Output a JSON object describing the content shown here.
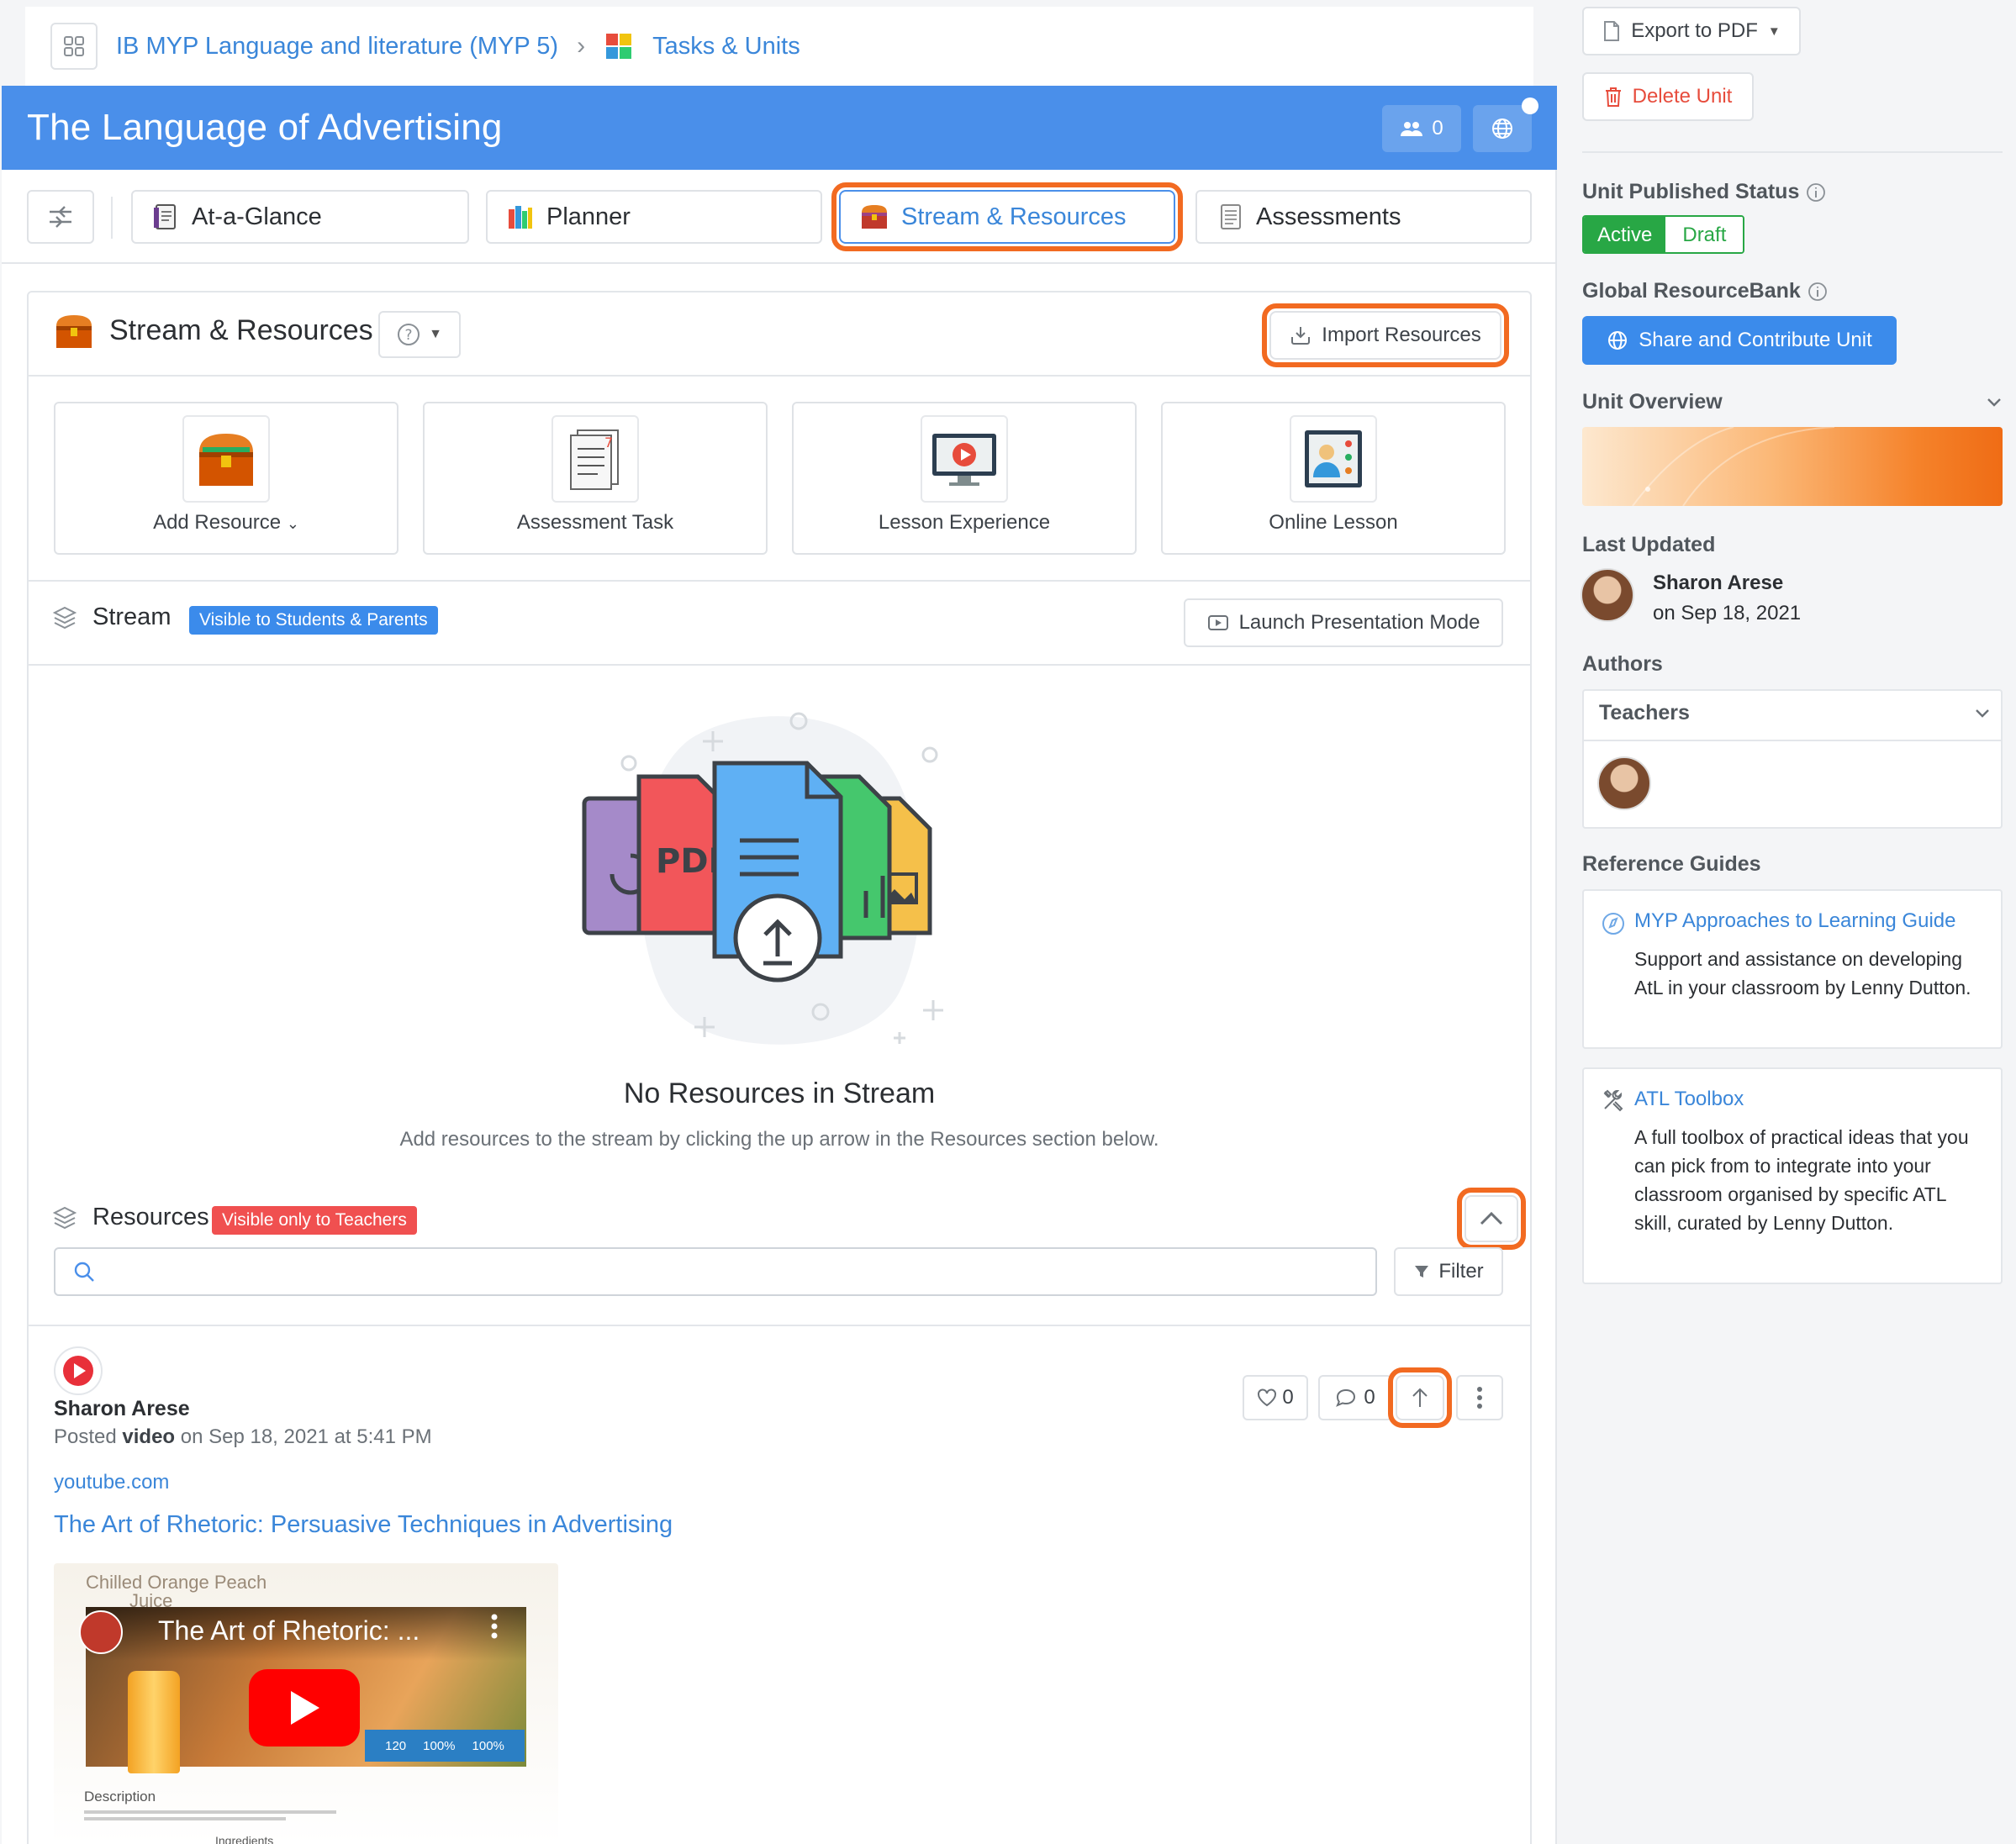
{
  "breadcrumb": {
    "course": "IB MYP Language and literature (MYP 5)",
    "section": "Tasks & Units"
  },
  "unit": {
    "title": "The Language of Advertising",
    "member_count": "0"
  },
  "tabs": [
    {
      "label": "At-a-Glance"
    },
    {
      "label": "Planner"
    },
    {
      "label": "Stream & Resources"
    },
    {
      "label": "Assessments"
    }
  ],
  "stream_resources": {
    "title": "Stream & Resources",
    "import_label": "Import Resources",
    "quick_actions": [
      {
        "label": "Add Resource"
      },
      {
        "label": "Assessment Task"
      },
      {
        "label": "Lesson Experience"
      },
      {
        "label": "Online Lesson"
      }
    ]
  },
  "stream": {
    "title": "Stream",
    "visibility_badge": "Visible to Students & Parents",
    "presentation_label": "Launch Presentation Mode",
    "empty_title": "No Resources in Stream",
    "empty_text": "Add resources to the stream by clicking the up arrow in the Resources section below."
  },
  "resources": {
    "title": "Resources",
    "visibility_badge": "Visible only to Teachers",
    "search_placeholder": "",
    "filter_label": "Filter"
  },
  "post": {
    "author": "Sharon Arese",
    "posted_prefix": "Posted ",
    "posted_type": "video",
    "posted_suffix": " on Sep 18, 2021 at 5:41 PM",
    "domain": "youtube.com",
    "title": "The Art of Rhetoric: Persuasive Techniques in Advertising",
    "likes": "0",
    "comments": "0",
    "thumbnail": {
      "product_text": "Chilled Orange Peach",
      "product_text_2": "Juice",
      "video_title": "The Art of Rhetoric: ...",
      "stat_1": "120",
      "stat_2": "100%",
      "stat_3": "100%",
      "description_label": "Description",
      "ingredients_label": "Ingredients"
    }
  },
  "sidebar": {
    "export_label": "Export to PDF",
    "delete_label": "Delete Unit",
    "published_status_label": "Unit Published Status",
    "status_active": "Active",
    "status_draft": "Draft",
    "resourcebank_label": "Global ResourceBank",
    "share_label": "Share and Contribute Unit",
    "overview_label": "Unit Overview",
    "last_updated_label": "Last Updated",
    "updated_by": "Sharon Arese",
    "updated_on": "on Sep 18, 2021",
    "authors_label": "Authors",
    "authors_group": "Teachers",
    "reference_label": "Reference Guides",
    "guides": [
      {
        "title": "MYP Approaches to Learning Guide",
        "text": "Support and assistance on developing AtL in your classroom by Lenny Dutton."
      },
      {
        "title": "ATL Toolbox",
        "text": "A full toolbox of practical ideas that you can pick from to integrate into your classroom organised by specific ATL skill, curated by Lenny Dutton."
      }
    ]
  },
  "colors": {
    "accent_blue": "#4a8fea",
    "highlight_orange": "#f26a21",
    "active_green": "#28a745",
    "badge_red": "#f05050"
  }
}
